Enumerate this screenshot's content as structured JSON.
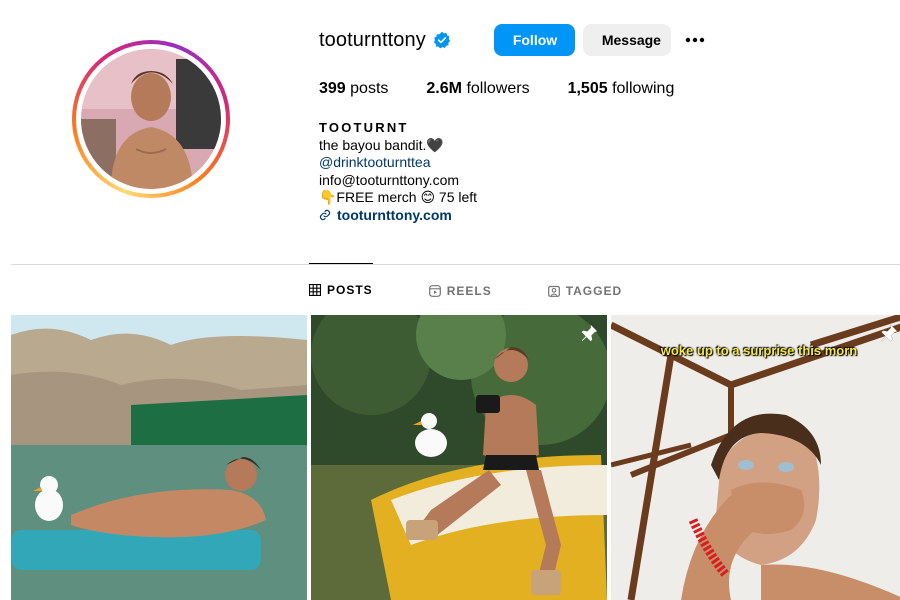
{
  "profile": {
    "username": "tooturnttony",
    "verified": true
  },
  "actions": {
    "follow_label": "Follow",
    "message_label": "Message"
  },
  "stats": {
    "posts_count": "399",
    "posts_label": "posts",
    "followers_count": "2.6M",
    "followers_label": "followers",
    "following_count": "1,505",
    "following_label": "following"
  },
  "bio": {
    "name": "TOOTURNT",
    "line1": "the bayou bandit.🖤",
    "mention": "@drinktooturnttea",
    "email": "info@tooturnttony.com",
    "merch": "👇FREE merch 😊 75 left",
    "link": "tooturnttony.com"
  },
  "tabs": [
    {
      "label": "POSTS",
      "icon": "grid-icon",
      "active": true
    },
    {
      "label": "REELS",
      "icon": "reels-icon",
      "active": false
    },
    {
      "label": "TAGGED",
      "icon": "tagged-icon",
      "active": false
    }
  ],
  "posts": [
    {
      "pinned": false,
      "caption": ""
    },
    {
      "pinned": true,
      "caption": ""
    },
    {
      "pinned": true,
      "caption": "woke up to a surprise this morn"
    }
  ],
  "colors": {
    "accent": "#0095f6",
    "link": "#00376b",
    "secondary_button": "#efefef",
    "muted": "#737373"
  }
}
